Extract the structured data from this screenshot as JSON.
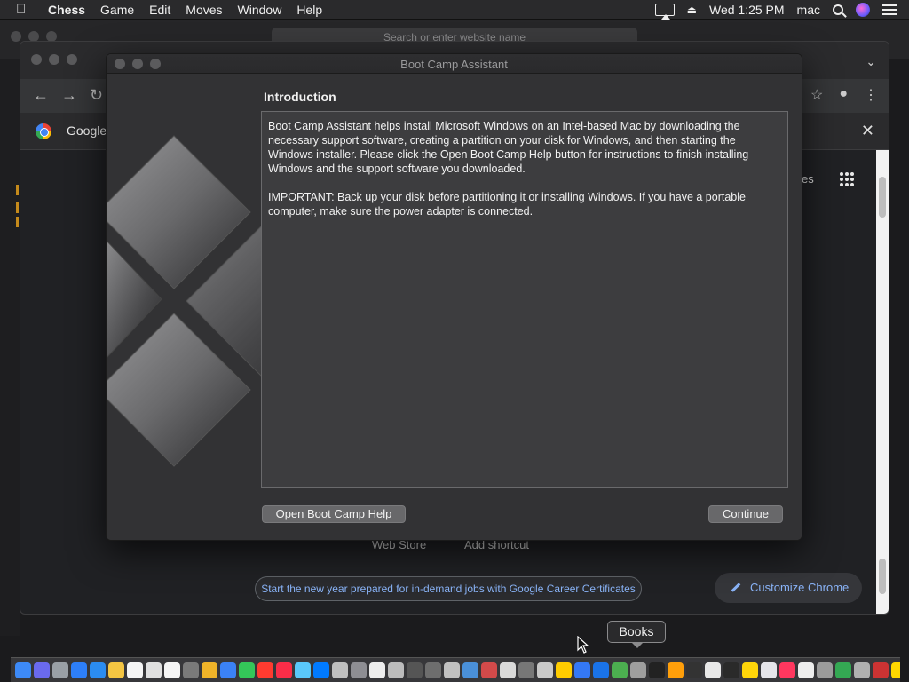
{
  "menubar": {
    "app_name": "Chess",
    "items": [
      "Game",
      "Edit",
      "Moves",
      "Window",
      "Help"
    ],
    "clock": "Wed 1:25 PM",
    "user": "mac"
  },
  "safari": {
    "address_placeholder": "Search or enter website name"
  },
  "chrome": {
    "bookmark": "Google",
    "apps_label": "es",
    "shortcuts": [
      "Web Store",
      "Add shortcut"
    ],
    "promo": "Start the new year prepared for in-demand jobs with Google Career Certificates",
    "customize": "Customize Chrome"
  },
  "bootcamp": {
    "window_title": "Boot Camp Assistant",
    "heading": "Introduction",
    "paragraph1": "Boot Camp Assistant helps install Microsoft Windows on an Intel-based Mac by downloading the necessary support software, creating a partition on your disk for Windows, and then starting the Windows installer. Please click the Open Boot Camp Help button for instructions to finish installing Windows and the support software you downloaded.",
    "paragraph2": "IMPORTANT:  Back up your disk before partitioning it or installing Windows. If you have a portable computer, make sure the power adapter is connected.",
    "help_button": "Open Boot Camp Help",
    "continue_button": "Continue"
  },
  "tooltip": {
    "label": "Books"
  },
  "dock": {
    "icon_colors": [
      "#3d8af7",
      "#6a6aee",
      "#9aa0a6",
      "#2d7ff9",
      "#2b8cf0",
      "#f4c542",
      "#f5f5f5",
      "#e0e0e0",
      "#f5f5f5",
      "#7a7a7a",
      "#f0b429",
      "#3b82f6",
      "#34c759",
      "#ff3b30",
      "#fa2d48",
      "#5ac8fa",
      "#007aff",
      "#bfbfbf",
      "#8e8e93",
      "#eeeeee",
      "#bcbcbc",
      "#555555",
      "#6e6e6e",
      "#c0c0c0",
      "#4a90d9",
      "#d24a4a",
      "#d9d9d9",
      "#777777",
      "#c9c9c9",
      "#ffcc00",
      "#3478f6",
      "#1a73e8",
      "#4caf50",
      "#9e9e9e",
      "#222222",
      "#ff9f0a",
      "#333333",
      "#e8e8e8",
      "#2a2a2a",
      "#ffd60a",
      "#e5e5ea",
      "#ff375f",
      "#eeeeee",
      "#9b9b9b",
      "#34a853",
      "#b0b0b0",
      "#cc3333",
      "#ffd700",
      "#aaaaaa",
      "#4285f4",
      "#c8c8c8",
      "#e0e0e0",
      "#888888"
    ]
  }
}
